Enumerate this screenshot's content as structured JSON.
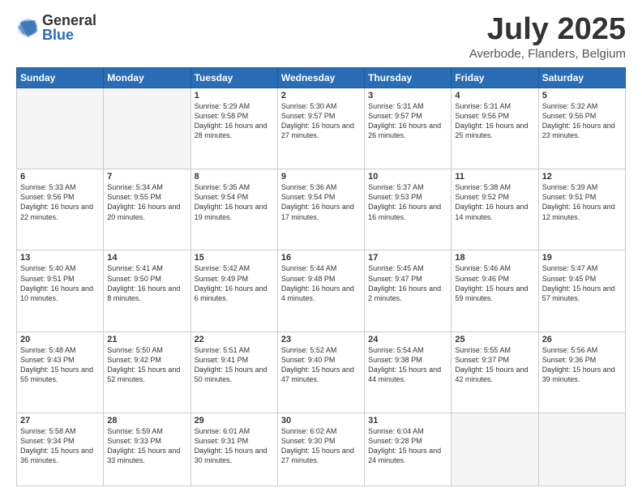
{
  "header": {
    "logo_general": "General",
    "logo_blue": "Blue",
    "month_title": "July 2025",
    "subtitle": "Averbode, Flanders, Belgium"
  },
  "days_of_week": [
    "Sunday",
    "Monday",
    "Tuesday",
    "Wednesday",
    "Thursday",
    "Friday",
    "Saturday"
  ],
  "weeks": [
    [
      {
        "day": "",
        "empty": true
      },
      {
        "day": "",
        "empty": true
      },
      {
        "day": "1",
        "sunrise": "5:29 AM",
        "sunset": "9:58 PM",
        "daylight": "16 hours and 28 minutes."
      },
      {
        "day": "2",
        "sunrise": "5:30 AM",
        "sunset": "9:57 PM",
        "daylight": "16 hours and 27 minutes."
      },
      {
        "day": "3",
        "sunrise": "5:31 AM",
        "sunset": "9:57 PM",
        "daylight": "16 hours and 26 minutes."
      },
      {
        "day": "4",
        "sunrise": "5:31 AM",
        "sunset": "9:56 PM",
        "daylight": "16 hours and 25 minutes."
      },
      {
        "day": "5",
        "sunrise": "5:32 AM",
        "sunset": "9:56 PM",
        "daylight": "16 hours and 23 minutes."
      }
    ],
    [
      {
        "day": "6",
        "sunrise": "5:33 AM",
        "sunset": "9:56 PM",
        "daylight": "16 hours and 22 minutes."
      },
      {
        "day": "7",
        "sunrise": "5:34 AM",
        "sunset": "9:55 PM",
        "daylight": "16 hours and 20 minutes."
      },
      {
        "day": "8",
        "sunrise": "5:35 AM",
        "sunset": "9:54 PM",
        "daylight": "16 hours and 19 minutes."
      },
      {
        "day": "9",
        "sunrise": "5:36 AM",
        "sunset": "9:54 PM",
        "daylight": "16 hours and 17 minutes."
      },
      {
        "day": "10",
        "sunrise": "5:37 AM",
        "sunset": "9:53 PM",
        "daylight": "16 hours and 16 minutes."
      },
      {
        "day": "11",
        "sunrise": "5:38 AM",
        "sunset": "9:52 PM",
        "daylight": "16 hours and 14 minutes."
      },
      {
        "day": "12",
        "sunrise": "5:39 AM",
        "sunset": "9:51 PM",
        "daylight": "16 hours and 12 minutes."
      }
    ],
    [
      {
        "day": "13",
        "sunrise": "5:40 AM",
        "sunset": "9:51 PM",
        "daylight": "16 hours and 10 minutes."
      },
      {
        "day": "14",
        "sunrise": "5:41 AM",
        "sunset": "9:50 PM",
        "daylight": "16 hours and 8 minutes."
      },
      {
        "day": "15",
        "sunrise": "5:42 AM",
        "sunset": "9:49 PM",
        "daylight": "16 hours and 6 minutes."
      },
      {
        "day": "16",
        "sunrise": "5:44 AM",
        "sunset": "9:48 PM",
        "daylight": "16 hours and 4 minutes."
      },
      {
        "day": "17",
        "sunrise": "5:45 AM",
        "sunset": "9:47 PM",
        "daylight": "16 hours and 2 minutes."
      },
      {
        "day": "18",
        "sunrise": "5:46 AM",
        "sunset": "9:46 PM",
        "daylight": "15 hours and 59 minutes."
      },
      {
        "day": "19",
        "sunrise": "5:47 AM",
        "sunset": "9:45 PM",
        "daylight": "15 hours and 57 minutes."
      }
    ],
    [
      {
        "day": "20",
        "sunrise": "5:48 AM",
        "sunset": "9:43 PM",
        "daylight": "15 hours and 55 minutes."
      },
      {
        "day": "21",
        "sunrise": "5:50 AM",
        "sunset": "9:42 PM",
        "daylight": "15 hours and 52 minutes."
      },
      {
        "day": "22",
        "sunrise": "5:51 AM",
        "sunset": "9:41 PM",
        "daylight": "15 hours and 50 minutes."
      },
      {
        "day": "23",
        "sunrise": "5:52 AM",
        "sunset": "9:40 PM",
        "daylight": "15 hours and 47 minutes."
      },
      {
        "day": "24",
        "sunrise": "5:54 AM",
        "sunset": "9:38 PM",
        "daylight": "15 hours and 44 minutes."
      },
      {
        "day": "25",
        "sunrise": "5:55 AM",
        "sunset": "9:37 PM",
        "daylight": "15 hours and 42 minutes."
      },
      {
        "day": "26",
        "sunrise": "5:56 AM",
        "sunset": "9:36 PM",
        "daylight": "15 hours and 39 minutes."
      }
    ],
    [
      {
        "day": "27",
        "sunrise": "5:58 AM",
        "sunset": "9:34 PM",
        "daylight": "15 hours and 36 minutes."
      },
      {
        "day": "28",
        "sunrise": "5:59 AM",
        "sunset": "9:33 PM",
        "daylight": "15 hours and 33 minutes."
      },
      {
        "day": "29",
        "sunrise": "6:01 AM",
        "sunset": "9:31 PM",
        "daylight": "15 hours and 30 minutes."
      },
      {
        "day": "30",
        "sunrise": "6:02 AM",
        "sunset": "9:30 PM",
        "daylight": "15 hours and 27 minutes."
      },
      {
        "day": "31",
        "sunrise": "6:04 AM",
        "sunset": "9:28 PM",
        "daylight": "15 hours and 24 minutes."
      },
      {
        "day": "",
        "empty": true
      },
      {
        "day": "",
        "empty": true
      }
    ]
  ]
}
